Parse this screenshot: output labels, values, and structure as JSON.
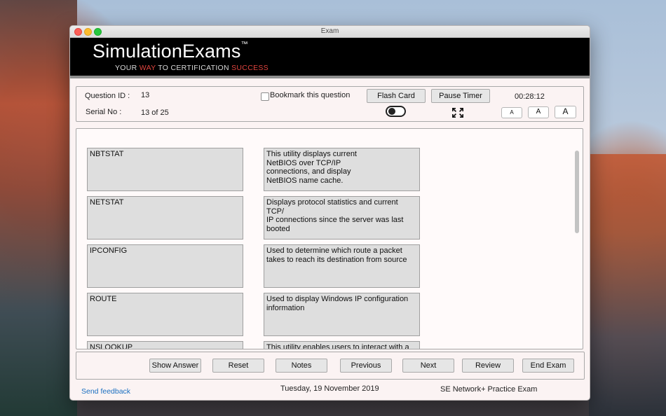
{
  "window": {
    "title": "Exam"
  },
  "banner": {
    "logo_name": "SimulationExams",
    "logo_tm": "™",
    "tagline_1": "YOUR ",
    "tagline_2": "WAY",
    "tagline_3": " TO CERTIFICATION ",
    "tagline_4": "SUCCESS"
  },
  "question_info": {
    "question_id_label": "Question ID :",
    "question_id_value": "13",
    "serial_label": "Serial No :",
    "serial_value": "13 of 25",
    "bookmark_label": "Bookmark this question",
    "bookmark_checked": false,
    "flash_card_label": "Flash Card",
    "flash_card_toggle_on": false,
    "pause_timer_label": "Pause Timer",
    "timer": "00:28:12",
    "font_small": "A",
    "font_medium": "A",
    "font_large": "A"
  },
  "matching": {
    "terms": [
      "NBTSTAT",
      "NETSTAT",
      "IPCONFIG",
      "ROUTE",
      "NSLOOKUP"
    ],
    "descriptions": [
      "This utility displays current\nNetBIOS over TCP/IP\nconnections, and display\nNetBIOS name cache.",
      "Displays protocol statistics and current TCP/\nIP connections since the server was last\nbooted",
      "Used to determine which route a packet\ntakes to reach its destination from source",
      "Used to display  Windows IP configuration\ninformation",
      "This utility enables users to interact with a"
    ]
  },
  "actions": {
    "show_answer": "Show Answer",
    "reset": "Reset",
    "notes": "Notes",
    "previous": "Previous",
    "next": "Next",
    "review": "Review",
    "end_exam": "End Exam"
  },
  "footer": {
    "feedback": "Send feedback",
    "date": "Tuesday, 19 November 2019",
    "exam_name": "SE Network+ Practice Exam"
  },
  "colors": {
    "banner_bg": "#000000",
    "tagline_accent": "#e0443e",
    "link": "#1a6fc0",
    "window_bg": "#fbf3f3"
  }
}
